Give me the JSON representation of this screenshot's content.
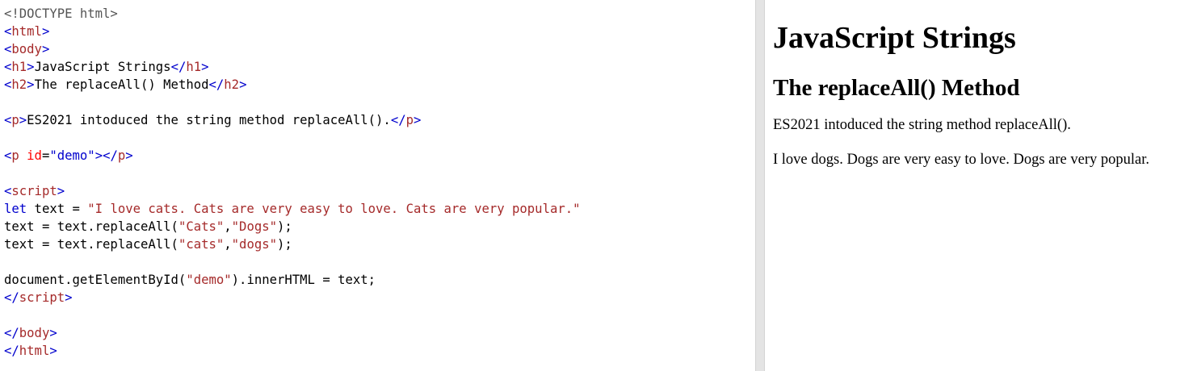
{
  "editor": {
    "lines": [
      [
        {
          "t": "<!DOCTYPE html>",
          "c": "doctype"
        }
      ],
      [
        {
          "t": "<",
          "c": "bracket"
        },
        {
          "t": "html",
          "c": "tag"
        },
        {
          "t": ">",
          "c": "bracket"
        }
      ],
      [
        {
          "t": "<",
          "c": "bracket"
        },
        {
          "t": "body",
          "c": "tag"
        },
        {
          "t": ">",
          "c": "bracket"
        }
      ],
      [
        {
          "t": "<",
          "c": "bracket"
        },
        {
          "t": "h1",
          "c": "tag"
        },
        {
          "t": ">",
          "c": "bracket"
        },
        {
          "t": "JavaScript Strings",
          "c": "text"
        },
        {
          "t": "</",
          "c": "bracket"
        },
        {
          "t": "h1",
          "c": "tag"
        },
        {
          "t": ">",
          "c": "bracket"
        }
      ],
      [
        {
          "t": "<",
          "c": "bracket"
        },
        {
          "t": "h2",
          "c": "tag"
        },
        {
          "t": ">",
          "c": "bracket"
        },
        {
          "t": "The replaceAll() Method",
          "c": "text"
        },
        {
          "t": "</",
          "c": "bracket"
        },
        {
          "t": "h2",
          "c": "tag"
        },
        {
          "t": ">",
          "c": "bracket"
        }
      ],
      [],
      [
        {
          "t": "<",
          "c": "bracket"
        },
        {
          "t": "p",
          "c": "tag"
        },
        {
          "t": ">",
          "c": "bracket"
        },
        {
          "t": "ES2021 intoduced the string method replaceAll().",
          "c": "text"
        },
        {
          "t": "</",
          "c": "bracket"
        },
        {
          "t": "p",
          "c": "tag"
        },
        {
          "t": ">",
          "c": "bracket"
        }
      ],
      [],
      [
        {
          "t": "<",
          "c": "bracket"
        },
        {
          "t": "p",
          "c": "tag"
        },
        {
          "t": " ",
          "c": "text"
        },
        {
          "t": "id",
          "c": "attr"
        },
        {
          "t": "=",
          "c": "text"
        },
        {
          "t": "\"demo\"",
          "c": "attrval"
        },
        {
          "t": "></",
          "c": "bracket"
        },
        {
          "t": "p",
          "c": "tag"
        },
        {
          "t": ">",
          "c": "bracket"
        }
      ],
      [],
      [
        {
          "t": "<",
          "c": "bracket"
        },
        {
          "t": "script",
          "c": "tag"
        },
        {
          "t": ">",
          "c": "bracket"
        }
      ],
      [
        {
          "t": "let",
          "c": "keyword"
        },
        {
          "t": " text = ",
          "c": "plain"
        },
        {
          "t": "\"I love cats. Cats are very easy to love. Cats are very popular.\"",
          "c": "string"
        }
      ],
      [
        {
          "t": "text = text.replaceAll(",
          "c": "plain"
        },
        {
          "t": "\"Cats\"",
          "c": "string"
        },
        {
          "t": ",",
          "c": "plain"
        },
        {
          "t": "\"Dogs\"",
          "c": "string"
        },
        {
          "t": ");",
          "c": "plain"
        }
      ],
      [
        {
          "t": "text = text.replaceAll(",
          "c": "plain"
        },
        {
          "t": "\"cats\"",
          "c": "string"
        },
        {
          "t": ",",
          "c": "plain"
        },
        {
          "t": "\"dogs\"",
          "c": "string"
        },
        {
          "t": ");",
          "c": "plain"
        }
      ],
      [],
      [
        {
          "t": "document.getElementById(",
          "c": "plain"
        },
        {
          "t": "\"demo\"",
          "c": "string"
        },
        {
          "t": ").innerHTML = text;",
          "c": "plain"
        }
      ],
      [
        {
          "t": "</",
          "c": "bracket"
        },
        {
          "t": "script",
          "c": "tag"
        },
        {
          "t": ">",
          "c": "bracket"
        }
      ],
      [],
      [
        {
          "t": "</",
          "c": "bracket"
        },
        {
          "t": "body",
          "c": "tag"
        },
        {
          "t": ">",
          "c": "bracket"
        }
      ],
      [
        {
          "t": "</",
          "c": "bracket"
        },
        {
          "t": "html",
          "c": "tag"
        },
        {
          "t": ">",
          "c": "bracket"
        }
      ]
    ]
  },
  "preview": {
    "h1": "JavaScript Strings",
    "h2": "The replaceAll() Method",
    "p1": "ES2021 intoduced the string method replaceAll().",
    "p2": "I love dogs. Dogs are very easy to love. Dogs are very popular."
  }
}
